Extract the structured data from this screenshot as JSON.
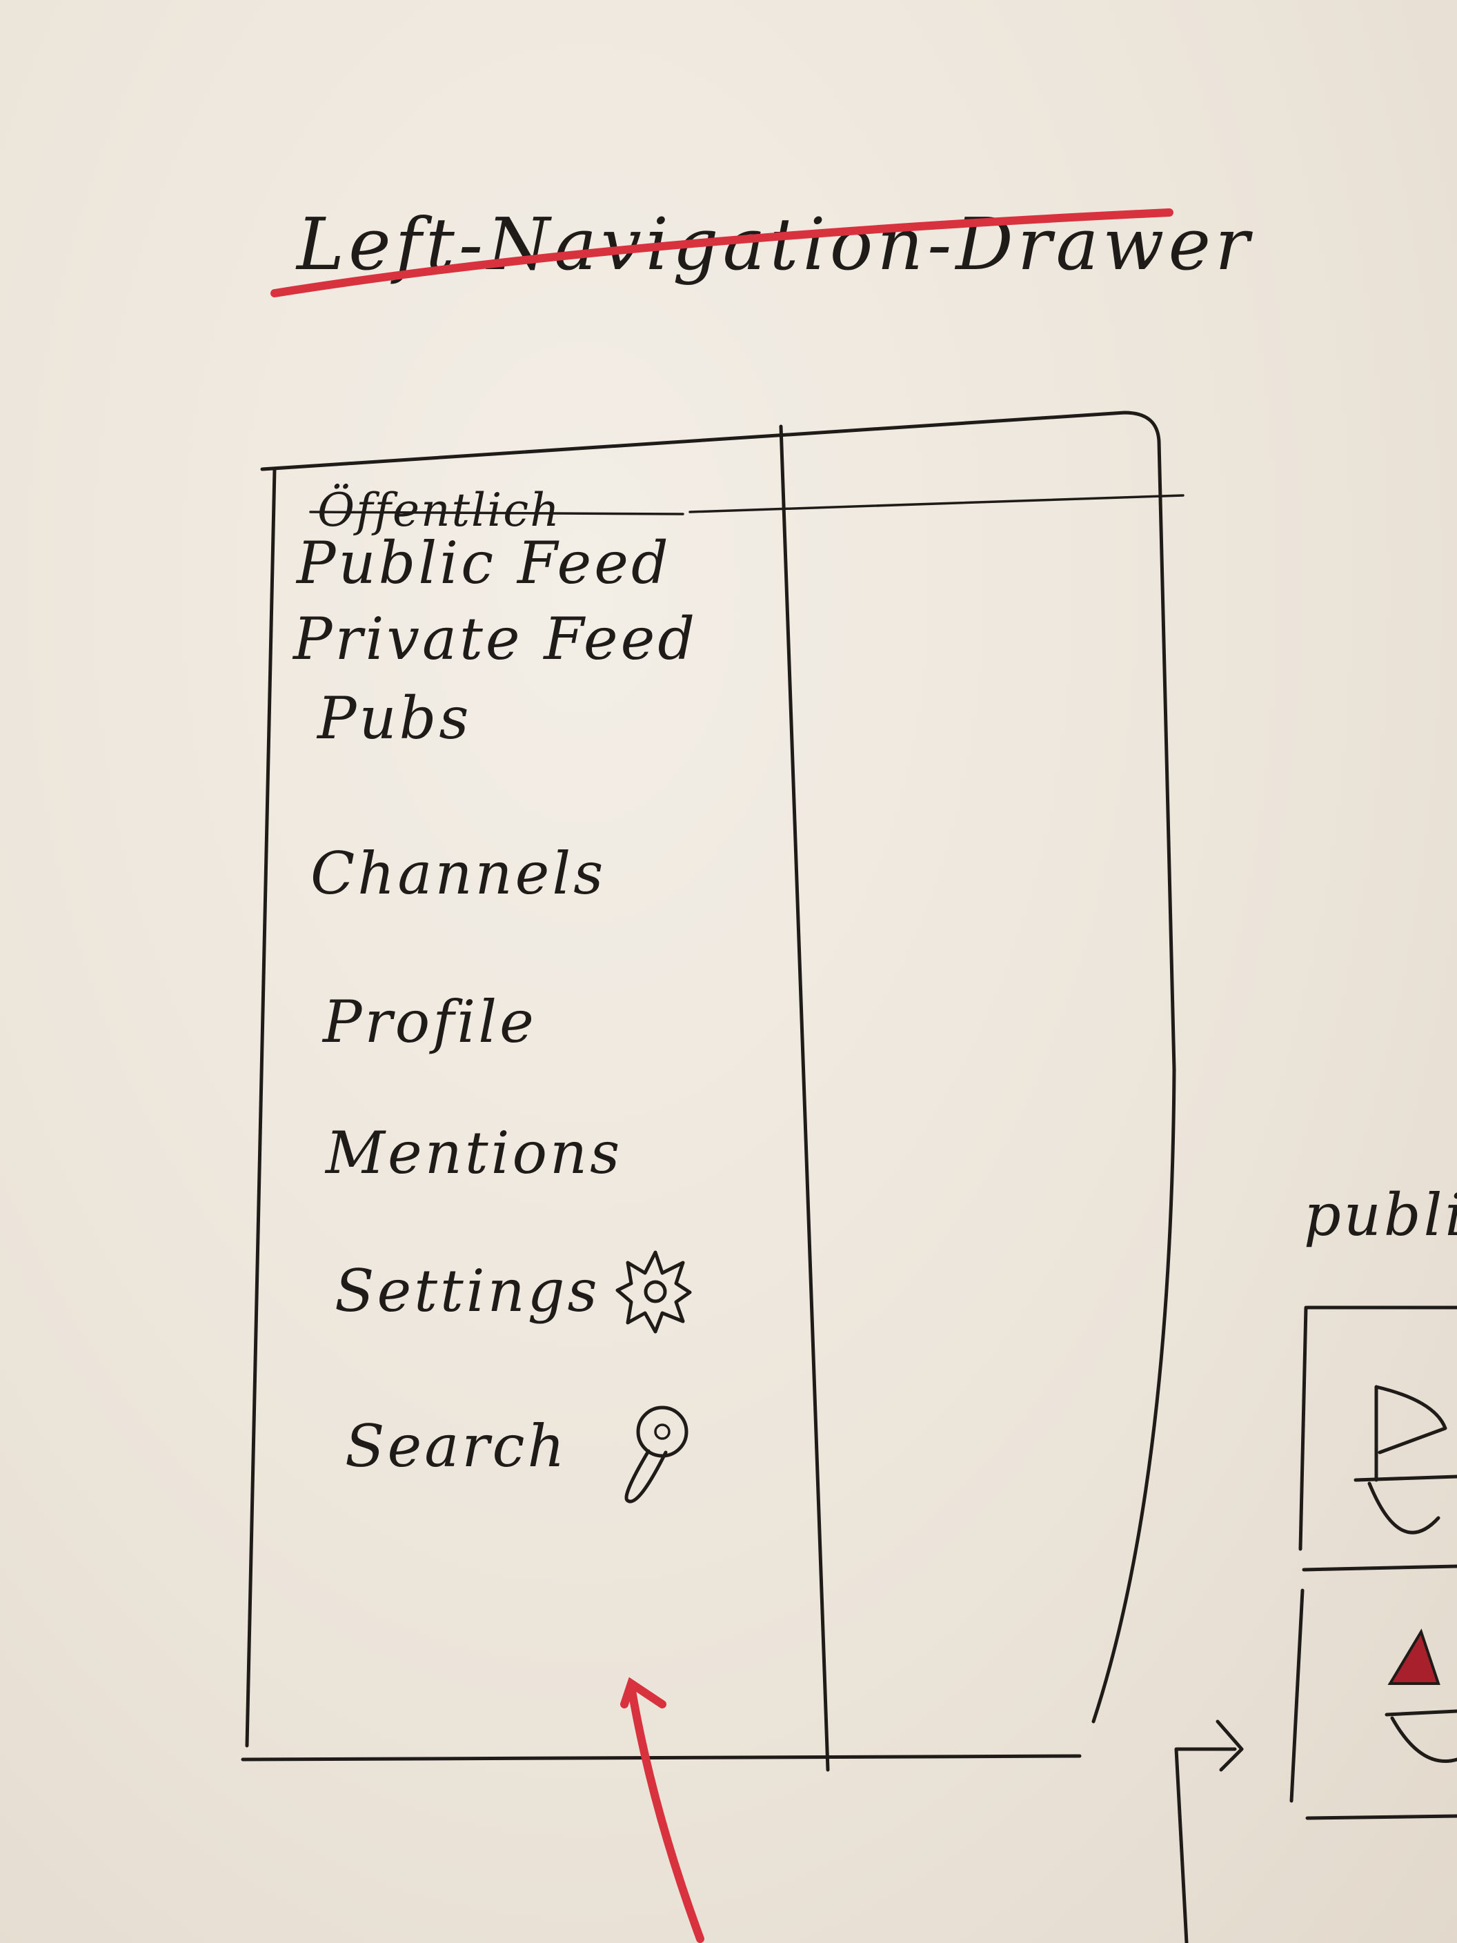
{
  "title": "Left-Navigation-Drawer",
  "drawer": {
    "crossed_out": "Öffentlich",
    "items": [
      {
        "label": "Public Feed"
      },
      {
        "label": "Private Feed"
      },
      {
        "label": "Pubs"
      },
      {
        "label": "Channels"
      },
      {
        "label": "Profile"
      },
      {
        "label": "Mentions"
      },
      {
        "label": "Settings",
        "icon": "gear-icon"
      },
      {
        "label": "Search",
        "icon": "search-icon"
      }
    ]
  },
  "side_sketch": {
    "label": "publi"
  },
  "colors": {
    "ink": "#1f1b18",
    "accent": "#d9323f",
    "paper": "#ece6dc"
  }
}
